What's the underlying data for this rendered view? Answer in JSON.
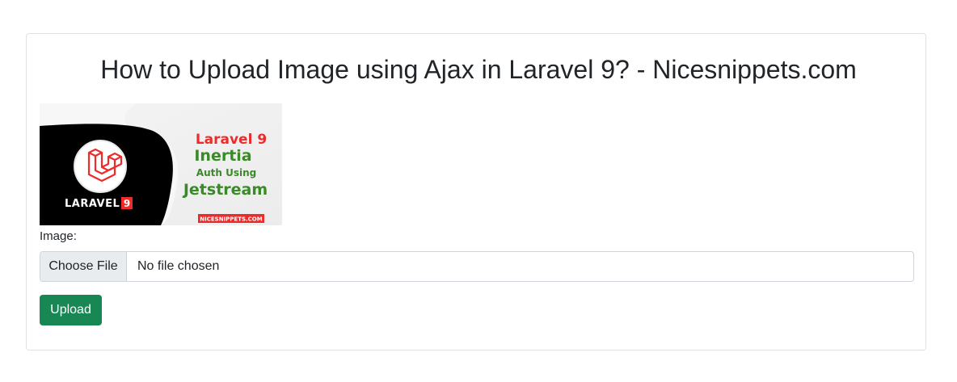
{
  "page": {
    "title": "How to Upload Image using Ajax in Laravel 9? - Nicesnippets.com"
  },
  "preview_image": {
    "brand_text": "LARAVEL",
    "brand_version": "9",
    "headline_line1": "Laravel 9",
    "headline_line2": "Inertia",
    "headline_line3": "Auth Using",
    "headline_line4": "Jetstream",
    "footer_tag": "NICESNIPPETS.COM",
    "logo_icon": "laravel-logo-icon",
    "colors": {
      "red": "#ee2b2b",
      "green": "#3a8a28",
      "dark": "#000000"
    }
  },
  "form": {
    "image_label": "Image:",
    "file_button_label": "Choose File",
    "file_status": "No file chosen",
    "submit_label": "Upload",
    "submit_color": "#198754"
  }
}
